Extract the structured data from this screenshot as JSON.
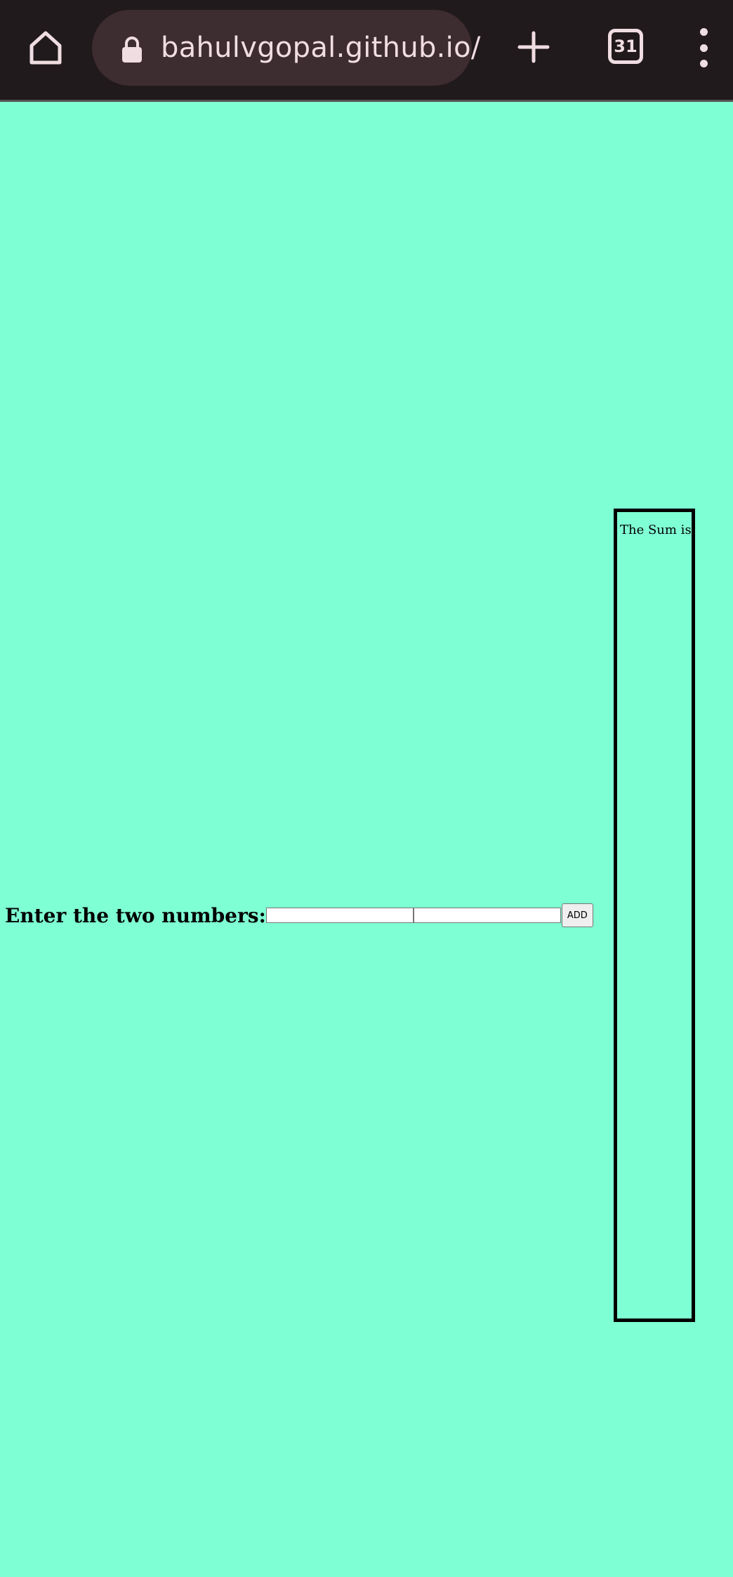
{
  "browser": {
    "url": "bahulvgopal.github.io/",
    "tab_count": "31",
    "icons": {
      "home": "home-icon",
      "lock": "lock-icon",
      "new_tab": "plus-icon",
      "tabs": "tab-switcher-icon",
      "menu": "more-vert-icon"
    },
    "colors": {
      "toolbar_bg": "#211a1c",
      "url_pill_bg": "#3d2c30",
      "icon_fg": "#f0dde2"
    }
  },
  "page": {
    "background": "#7fffd4",
    "form": {
      "label": "Enter the two numbers:",
      "input1": {
        "value": "",
        "placeholder": ""
      },
      "input2": {
        "value": "",
        "placeholder": ""
      },
      "add_label": "ADD"
    },
    "result": {
      "label": "The Sum is:",
      "value": ""
    }
  }
}
